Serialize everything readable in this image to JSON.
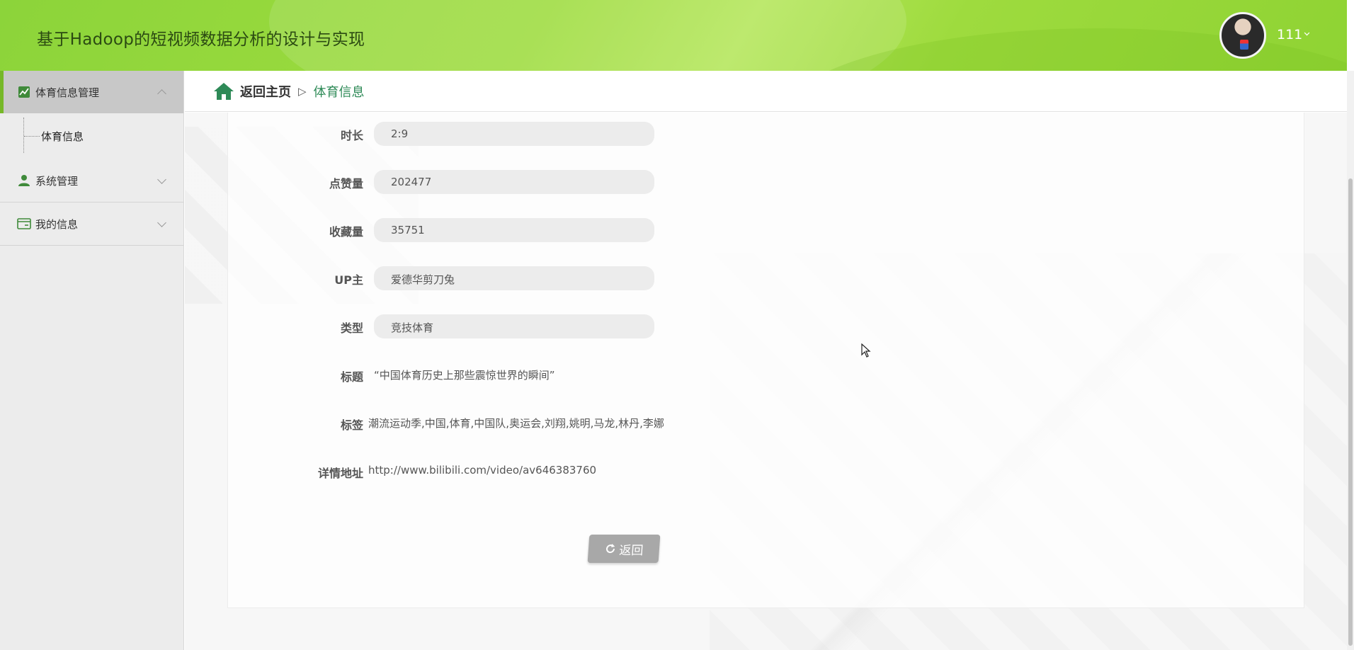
{
  "header": {
    "app_title": "基于Hadoop的短视频数据分析的设计与实现",
    "user_name": "111"
  },
  "sidebar": {
    "groups": [
      {
        "label": "体育信息管理",
        "icon": "chart-line-icon",
        "expanded": true,
        "items": [
          {
            "label": "体育信息"
          }
        ]
      },
      {
        "label": "系统管理",
        "icon": "user-icon",
        "expanded": false
      },
      {
        "label": "我的信息",
        "icon": "id-card-icon",
        "expanded": false
      }
    ]
  },
  "breadcrumb": {
    "home_label": "返回主页",
    "separator": "▷",
    "current": "体育信息"
  },
  "form": {
    "duration": {
      "label": "时长",
      "value": "2:9"
    },
    "likes": {
      "label": "点赞量",
      "value": "202477"
    },
    "favorites": {
      "label": "收藏量",
      "value": "35751"
    },
    "uploader": {
      "label": "UP主",
      "value": "爱德华剪刀兔"
    },
    "category": {
      "label": "类型",
      "value": "竞技体育"
    },
    "title": {
      "label": "标题",
      "value": "“中国体育历史上那些震惊世界的瞬间”"
    },
    "tags": {
      "label": "标签",
      "value": "潮流运动季,中国,体育,中国队,奥运会,刘翔,姚明,马龙,林丹,李娜"
    },
    "detail_url": {
      "label": "详情地址",
      "value": "http://www.bilibili.com/video/av646383760"
    }
  },
  "actions": {
    "back_label": "返回"
  },
  "colors": {
    "header_green": "#9edc3f",
    "accent_green": "#76b828",
    "breadcrumb_current": "#2e8a57",
    "button_gray": "#a8a8a8"
  }
}
